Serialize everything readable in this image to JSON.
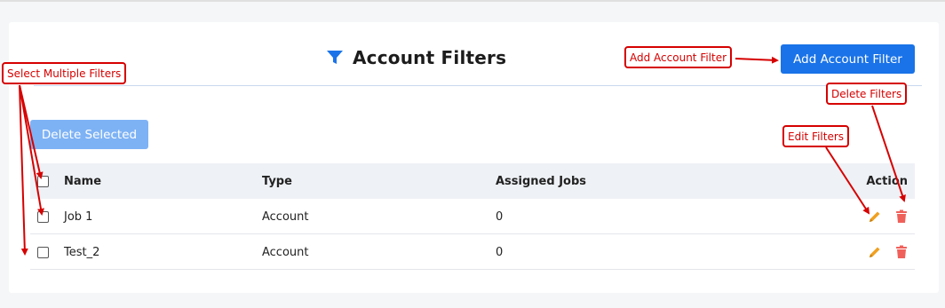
{
  "page": {
    "title": "Account Filters",
    "add_button_label": "Add Account Filter",
    "delete_selected_label": "Delete Selected"
  },
  "table": {
    "columns": [
      "Name",
      "Type",
      "Assigned Jobs",
      "Action"
    ],
    "rows": [
      {
        "name": "Job 1",
        "type": "Account",
        "assigned_jobs": "0"
      },
      {
        "name": "Test_2",
        "type": "Account",
        "assigned_jobs": "0"
      }
    ]
  },
  "annotations": {
    "select_multiple": "Select Multiple Filters",
    "add_filter": "Add Account Filter",
    "delete_filters": "Delete Filters",
    "edit_filters": "Edit Filters"
  },
  "icons": {
    "title": "filter-icon",
    "edit": "pencil-icon",
    "delete": "trash-icon"
  },
  "colors": {
    "primary": "#1a73e8",
    "primary_disabled": "#7db2f5",
    "edit_icon": "#f0a020",
    "delete_icon": "#f0605a",
    "annotation": "#d60000"
  }
}
